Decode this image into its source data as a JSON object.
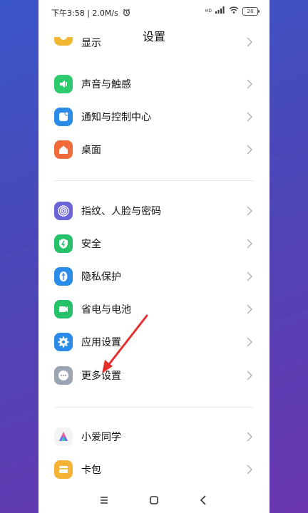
{
  "status": {
    "time": "下午3:58",
    "speed": "2.0M/s",
    "signal_label": "HD",
    "battery": "28"
  },
  "header": {
    "title": "设置"
  },
  "items": [
    {
      "label": "显示",
      "color": "#f2b632",
      "icon": "sun-icon"
    },
    {
      "label": "声音与触感",
      "color": "#2dcb6d",
      "icon": "speaker-icon"
    },
    {
      "label": "通知与控制中心",
      "color": "#2a8ce8",
      "icon": "notification-icon"
    },
    {
      "label": "桌面",
      "color": "#f06a3a",
      "icon": "home-icon"
    },
    {
      "label": "指纹、人脸与密码",
      "color": "#6b64d8",
      "icon": "fingerprint-icon"
    },
    {
      "label": "安全",
      "color": "#25c26a",
      "icon": "shield-icon"
    },
    {
      "label": "隐私保护",
      "color": "#2a8ce8",
      "icon": "privacy-icon"
    },
    {
      "label": "省电与电池",
      "color": "#25c26a",
      "icon": "battery-saver-icon"
    },
    {
      "label": "应用设置",
      "color": "#2a8ce8",
      "icon": "gear-icon"
    },
    {
      "label": "更多设置",
      "color": "#9aa4b2",
      "icon": "more-icon"
    },
    {
      "label": "小爱同学",
      "color": "#ffffff",
      "icon": "xiaoai-icon"
    },
    {
      "label": "卡包",
      "color": "#f5b335",
      "icon": "wallet-icon"
    }
  ],
  "annotation": {
    "color": "#e53030"
  }
}
